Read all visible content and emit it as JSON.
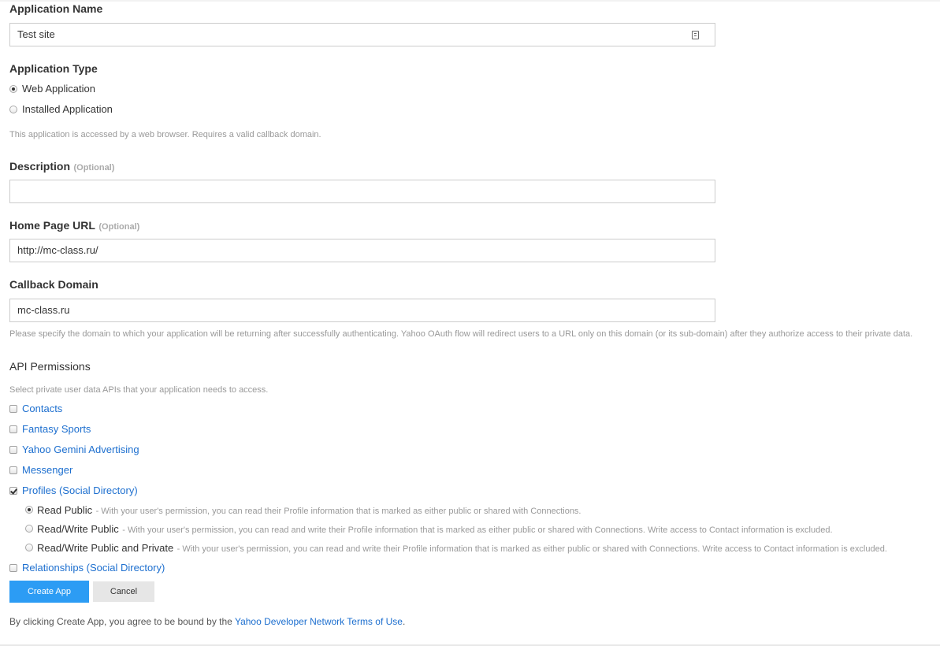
{
  "form": {
    "app_name": {
      "label": "Application Name",
      "value": "Test site"
    },
    "app_type": {
      "label": "Application Type",
      "options": [
        {
          "label": "Web Application",
          "checked": true
        },
        {
          "label": "Installed Application",
          "checked": false
        }
      ],
      "help": "This application is accessed by a web browser. Requires a valid callback domain."
    },
    "description": {
      "label": "Description",
      "optional": "(Optional)",
      "value": ""
    },
    "home_page_url": {
      "label": "Home Page URL",
      "optional": "(Optional)",
      "value": "http://mc-class.ru/"
    },
    "callback_domain": {
      "label": "Callback Domain",
      "value": "mc-class.ru",
      "help": "Please specify the domain to which your application will be returning after successfully authenticating. Yahoo OAuth flow will redirect users to a URL only on this domain (or its sub-domain) after they authorize access to their private data."
    }
  },
  "api_permissions": {
    "title": "API Permissions",
    "help": "Select private user data APIs that your application needs to access.",
    "items": [
      {
        "label": "Contacts",
        "checked": false
      },
      {
        "label": "Fantasy Sports",
        "checked": false
      },
      {
        "label": "Yahoo Gemini Advertising",
        "checked": false
      },
      {
        "label": "Messenger",
        "checked": false
      },
      {
        "label": "Profiles (Social Directory)",
        "checked": true
      },
      {
        "label": "Relationships (Social Directory)",
        "checked": false
      }
    ],
    "profiles_options": [
      {
        "label": "Read Public",
        "desc": "- With your user's permission, you can read their Profile information that is marked as either public or shared with Connections.",
        "checked": true
      },
      {
        "label": "Read/Write Public",
        "desc": "- With your user's permission, you can read and write their Profile information that is marked as either public or shared with Connections. Write access to Contact information is excluded.",
        "checked": false
      },
      {
        "label": "Read/Write Public and Private",
        "desc": "- With your user's permission, you can read and write their Profile information that is marked as either public or shared with Connections. Write access to Contact information is excluded.",
        "checked": false
      }
    ]
  },
  "buttons": {
    "create": "Create App",
    "cancel": "Cancel"
  },
  "footer": {
    "prefix": "By clicking Create App, you agree to be bound by the ",
    "link": "Yahoo Developer Network Terms of Use",
    "suffix": "."
  },
  "colors": {
    "link": "#1d6fcf",
    "primary_button": "#2c9cf4",
    "secondary_button": "#e6e6e6"
  }
}
